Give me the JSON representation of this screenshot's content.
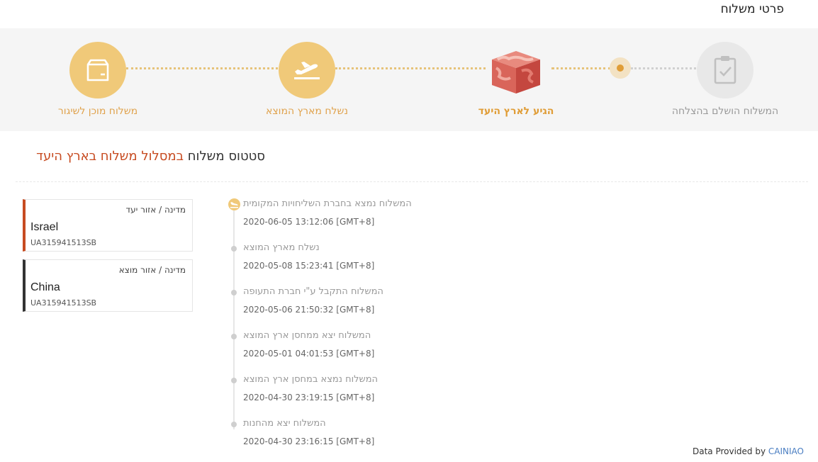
{
  "page_title": "פרטי משלוח",
  "steps": [
    {
      "label": "משלוח מוכן לשיגור",
      "icon": "package-icon",
      "state": "done"
    },
    {
      "label": "נשלח מארץ המוצא",
      "icon": "airplane-takeoff-icon",
      "state": "done"
    },
    {
      "label": "הגיע לארץ היעד",
      "icon": "cube-map-icon",
      "state": "current"
    },
    {
      "label": "המשלוח הושלם בהצלחה",
      "icon": "clipboard-check-icon",
      "state": "pending"
    }
  ],
  "status": {
    "prefix": "סטטוס משלוח",
    "value": "במסלול משלוח בארץ היעד"
  },
  "cards": [
    {
      "label": "מדינה / אזור יעד",
      "country": "Israel",
      "tracking": "UA315941513SB"
    },
    {
      "label": "מדינה / אזור מוצא",
      "country": "China",
      "tracking": "UA315941513SB"
    }
  ],
  "events": [
    {
      "desc": "המשלוח נמצא בחברת השליחויות המקומית",
      "time": "2020-06-05 13:12:06 [GMT+8]"
    },
    {
      "desc": "נשלח מארץ המוצא",
      "time": "2020-05-08 15:23:41 [GMT+8]"
    },
    {
      "desc": "המשלוח התקבל ע\"י חברת התעופה",
      "time": "2020-05-06 21:50:32 [GMT+8]"
    },
    {
      "desc": "המשלוח יצא ממחסן ארץ המוצא",
      "time": "2020-05-01 04:01:53 [GMT+8]"
    },
    {
      "desc": "המשלוח נמצא במחסן ארץ המוצא",
      "time": "2020-04-30 23:19:15 [GMT+8]"
    },
    {
      "desc": "המשלוח יצא מהחנות",
      "time": "2020-04-30 23:16:15 [GMT+8]"
    }
  ],
  "footer": {
    "text": "Data Provided by",
    "brand": "CAINIAO"
  },
  "colors": {
    "gold": "#f0c979",
    "accent": "#c74b21",
    "current": "#e09d37",
    "brand": "#4a7ec2"
  }
}
